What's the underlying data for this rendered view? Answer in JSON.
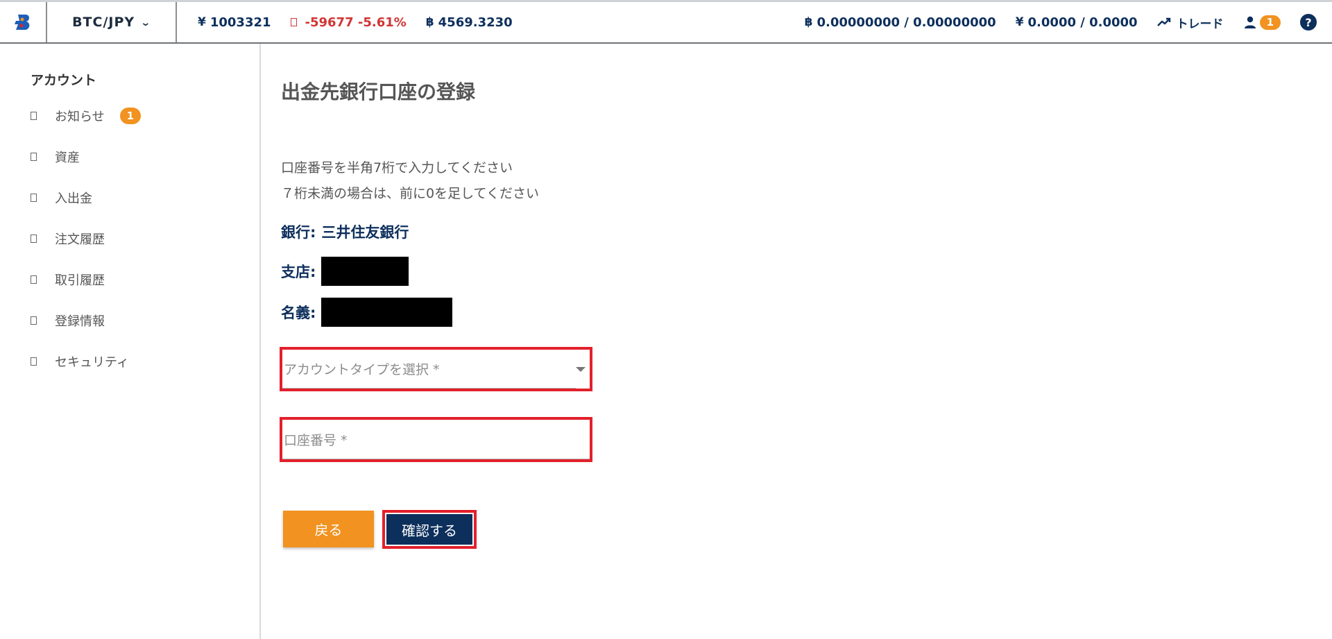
{
  "header": {
    "pair": "BTC/JPY",
    "price_symbol": "¥",
    "price": "1003321",
    "change": "-59677 -5.61%",
    "volume_symbol": "฿",
    "volume": "4569.3230",
    "btc_symbol": "฿",
    "btc_balance": "0.00000000 / 0.00000000",
    "jpy_symbol": "¥",
    "jpy_balance": "0.0000 / 0.0000",
    "trade_label": "トレード",
    "user_badge": "1",
    "help_label": "?"
  },
  "sidebar": {
    "title": "アカウント",
    "items": [
      {
        "label": "お知らせ",
        "badge": "1"
      },
      {
        "label": "資産"
      },
      {
        "label": "入出金"
      },
      {
        "label": "注文履歴"
      },
      {
        "label": "取引履歴"
      },
      {
        "label": "登録情報"
      },
      {
        "label": "セキュリティ"
      }
    ]
  },
  "main": {
    "title": "出金先銀行口座の登録",
    "note1": "口座番号を半角7桁で入力してください",
    "note2": "７桁未満の場合は、前に0を足してください",
    "bank_label": "銀行:",
    "bank_value": "三井住友銀行",
    "branch_label": "支店:",
    "name_label": "名義:",
    "account_type_placeholder": "アカウントタイプを選択 *",
    "account_number_placeholder": "口座番号 *",
    "back_button": "戻る",
    "confirm_button": "確認する"
  },
  "colors": {
    "navy": "#0d2f5c",
    "orange": "#f19221",
    "negative": "#d13535",
    "highlight": "#e2202b"
  }
}
